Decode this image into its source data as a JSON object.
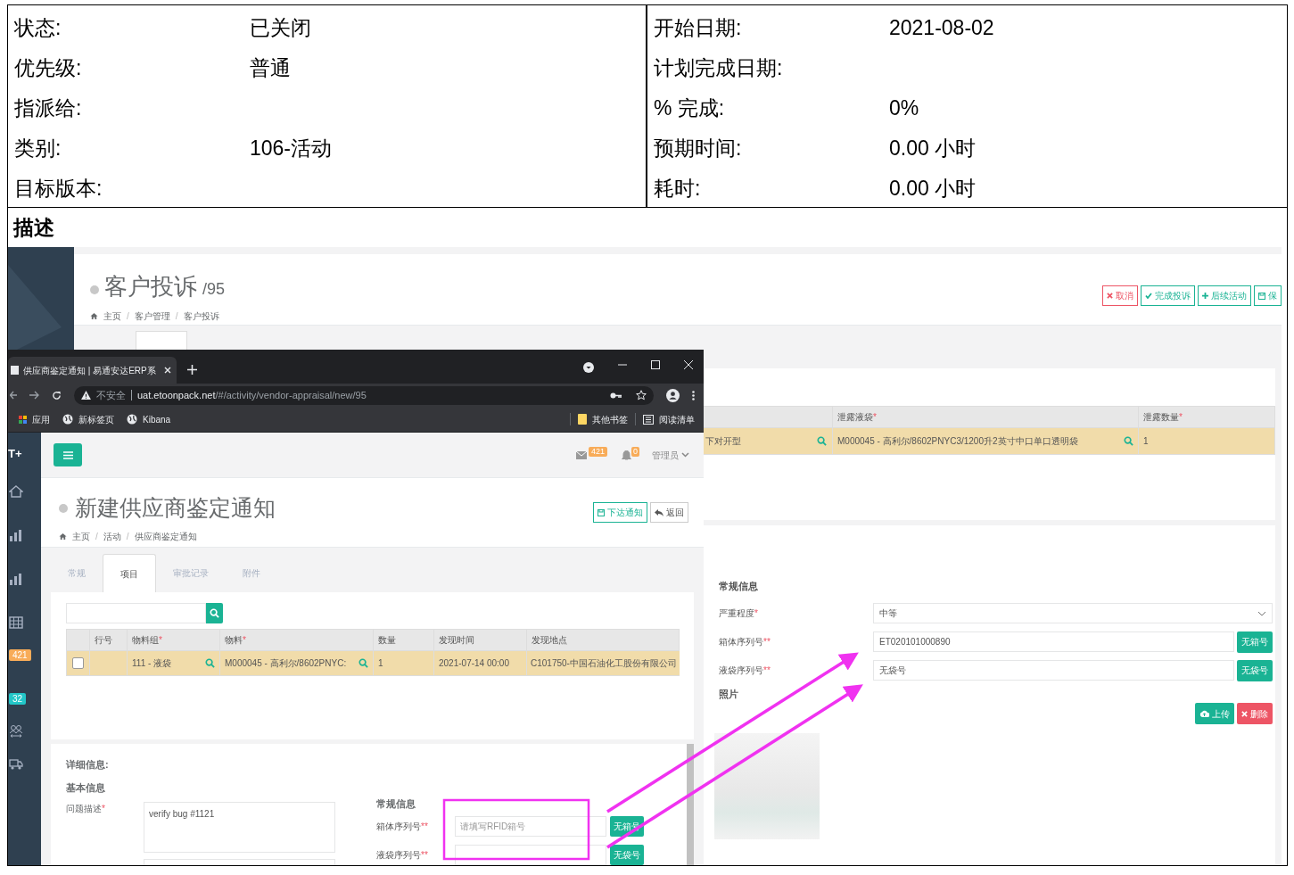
{
  "info_table": {
    "left": [
      {
        "label": "状态:",
        "value": "已关闭"
      },
      {
        "label": "优先级:",
        "value": "普通"
      },
      {
        "label": "指派给:"
      },
      {
        "label": "类别:",
        "value": "106-活动"
      },
      {
        "label": "目标版本:"
      }
    ],
    "right": [
      {
        "label": "开始日期:",
        "value": "2021-08-02"
      },
      {
        "label": "计划完成日期:"
      },
      {
        "label": "% 完成:",
        "value": "0%"
      },
      {
        "label": "预期时间:",
        "value": "0.00 小时"
      },
      {
        "label": "耗时:",
        "value": "0.00 小时"
      }
    ]
  },
  "description": {
    "heading": "描述",
    "back_app": {
      "title": "客户投诉",
      "title_suffix": "/95",
      "breadcrumb": [
        "主页",
        "客户管理",
        "客户投诉"
      ],
      "breadcrumb_separator": "/",
      "actions": [
        {
          "label": "取消",
          "kind": "cancel"
        },
        {
          "label": "完成投诉",
          "kind": "complete"
        },
        {
          "label": "后续活动",
          "kind": "add"
        },
        {
          "label": "保",
          "kind": "save"
        }
      ],
      "table": {
        "columns": [
          {},
          {
            "label": "泄露液袋",
            "mark": "*"
          },
          {
            "label": "泄露数量",
            "mark": "*"
          }
        ],
        "rows": [
          {
            "cells": [
              "下对开型",
              "M000045 - 高利尔/8602PNYC3/1200升2英寸中口单口透明袋",
              "1"
            ]
          }
        ]
      },
      "form": {
        "heading": "常规信息",
        "fields": [
          {
            "kind": "select",
            "label": "严重程度",
            "mark": "*",
            "value": "中等"
          },
          {
            "kind": "input",
            "label": "箱体序列号",
            "mark": "**",
            "value": "ET020101000890",
            "button": "无箱号"
          },
          {
            "kind": "input",
            "label": "液袋序列号",
            "mark": "**",
            "value": "无袋号",
            "button": "无袋号"
          }
        ],
        "photo_heading": "照片",
        "upload": "上传",
        "delete": "删除"
      }
    },
    "browser": {
      "tab_title": "供应商鉴定通知 | 易通安达ERP系",
      "security": "不安全",
      "host": "uat.etoonpack.net",
      "path": "/#/activity/vendor-appraisal/new/95",
      "bookmarks": [
        {
          "kind": "apps",
          "label": "应用"
        },
        {
          "kind": "globe",
          "label": "新标签页"
        },
        {
          "kind": "globe",
          "label": "Kibana"
        }
      ],
      "bookmarks_right": [
        {
          "kind": "folder",
          "label": "其他书签"
        },
        {
          "kind": "list",
          "label": "阅读清单"
        }
      ],
      "app": {
        "logo": "T+",
        "sidebar_badges": [
          {
            "count": "421",
            "color": "#f8ac59"
          },
          {
            "count": "32",
            "color": "#23c6c8"
          }
        ],
        "mail_badge": "421",
        "bell_badge": "0",
        "user": "管理员",
        "title": "新建供应商鉴定通知",
        "breadcrumb": [
          "主页",
          "活动",
          "供应商鉴定通知"
        ],
        "breadcrumb_separator": "/",
        "actions": [
          {
            "kind": "primary",
            "label": "下达通知"
          },
          {
            "kind": "default",
            "label": "返回"
          }
        ],
        "tabs": [
          {
            "label": "常规",
            "selected": false
          },
          {
            "label": "项目",
            "selected": true
          },
          {
            "label": "审批记录",
            "selected": false
          },
          {
            "label": "附件",
            "selected": false
          }
        ],
        "table": {
          "columns": [
            {
              "label": "行号"
            },
            {
              "label": "物料组",
              "mark": "*"
            },
            {
              "label": "物料",
              "mark": "*"
            },
            {
              "label": "数量"
            },
            {
              "label": "发现时间"
            },
            {
              "label": "发现地点"
            }
          ],
          "rows": [
            {
              "checked": false,
              "material_group": "111 - 液袋",
              "material": "M000045 - 高利尔/8602PNYC:",
              "quantity": "1",
              "found_time": "2021-07-14 00:00",
              "found_place": "C101750-中国石油化工股份有限公司"
            }
          ]
        },
        "detail": {
          "heading": "详细信息:",
          "basic_heading": "基本信息",
          "problem_label": "问题描述",
          "problem_mark": "*",
          "problem_value": "verify bug #1121",
          "general_heading": "常规信息",
          "fields": [
            {
              "label": "箱体序列号",
              "mark": "**",
              "placeholder": "请填写RFID箱号",
              "button": "无箱号"
            },
            {
              "label": "液袋序列号",
              "mark": "**",
              "button": "无袋号"
            }
          ]
        }
      }
    }
  }
}
